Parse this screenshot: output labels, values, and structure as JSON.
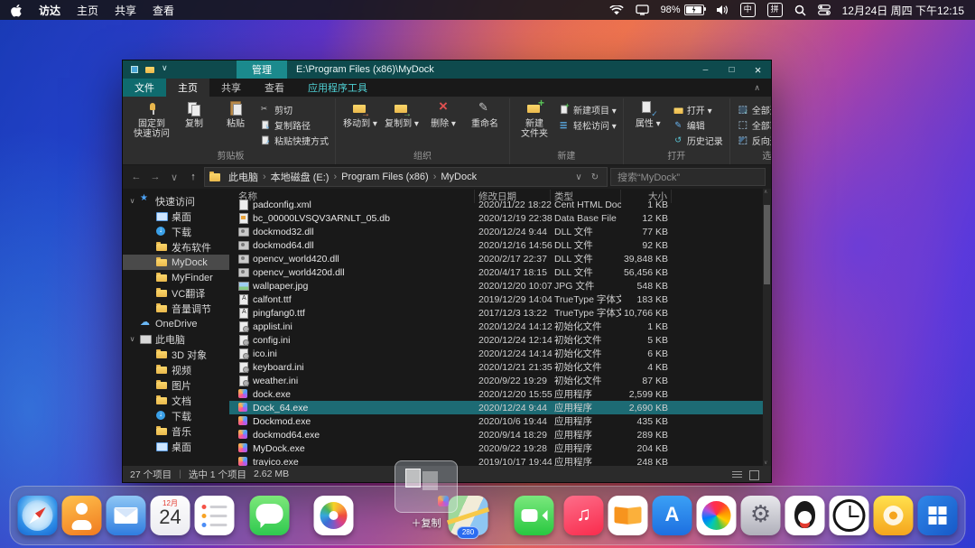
{
  "colors": {
    "accent_teal": "#1b8a8d",
    "selection_teal": "#1d6b74",
    "title_bar": "#0e4a4d"
  },
  "menubar": {
    "items": [
      "访达",
      "主页",
      "共享",
      "查看"
    ],
    "battery": "98%",
    "ime1": "中",
    "ime2": "拼",
    "datetime": "12月24日 周四 下午12:15"
  },
  "explorer": {
    "titlebar": {
      "contextual_tab": "管理",
      "title": "E:\\Program Files (x86)\\MyDock"
    },
    "tabs": [
      {
        "key": "file",
        "label": "文件",
        "file": true
      },
      {
        "key": "home",
        "label": "主页",
        "active": true
      },
      {
        "key": "share",
        "label": "共享"
      },
      {
        "key": "view",
        "label": "查看"
      },
      {
        "key": "app-tools",
        "label": "应用程序工具",
        "contextual": true
      }
    ],
    "ribbon_groups": [
      {
        "key": "clipboard",
        "label": "剪贴板",
        "large": [
          {
            "key": "pin-quick-access",
            "icon": "pin",
            "lines": [
              "固定到",
              "快速访问"
            ]
          },
          {
            "key": "copy",
            "icon": "copy",
            "lines": [
              "复制"
            ]
          },
          {
            "key": "paste",
            "icon": "paste",
            "lines": [
              "粘贴"
            ]
          }
        ],
        "small": [
          {
            "key": "cut",
            "icon": "cut",
            "label": "剪切"
          },
          {
            "key": "copy-path",
            "icon": "copypath",
            "label": "复制路径"
          },
          {
            "key": "paste-shortcut",
            "icon": "shortcut",
            "label": "粘贴快捷方式"
          }
        ]
      },
      {
        "key": "organize",
        "label": "组织",
        "large": [
          {
            "key": "move-to",
            "icon": "moveto",
            "lines": [
              "移动到"
            ],
            "dropdown": true
          },
          {
            "key": "copy-to",
            "icon": "copyto",
            "lines": [
              "复制到"
            ],
            "dropdown": true
          },
          {
            "key": "delete",
            "icon": "delete",
            "lines": [
              "删除"
            ],
            "dropdown": true
          },
          {
            "key": "rename",
            "icon": "rename",
            "lines": [
              "重命名"
            ]
          }
        ],
        "small": []
      },
      {
        "key": "new",
        "label": "新建",
        "large": [
          {
            "key": "new-folder",
            "icon": "newfolder",
            "lines": [
              "新建",
              "文件夹"
            ]
          }
        ],
        "small": [
          {
            "key": "new-item",
            "icon": "newitem",
            "label": "新建项目",
            "dropdown": true
          },
          {
            "key": "easy-access",
            "icon": "easyaccess",
            "label": "轻松访问",
            "dropdown": true
          }
        ]
      },
      {
        "key": "open",
        "label": "打开",
        "large": [
          {
            "key": "properties",
            "icon": "props",
            "lines": [
              "属性"
            ],
            "dropdown": true
          }
        ],
        "small": [
          {
            "key": "open",
            "icon": "open",
            "label": "打开",
            "dropdown": true
          },
          {
            "key": "edit",
            "icon": "edit",
            "label": "编辑"
          },
          {
            "key": "history",
            "icon": "history",
            "label": "历史记录"
          }
        ]
      },
      {
        "key": "select",
        "label": "选择",
        "large": [],
        "small": [
          {
            "key": "select-all",
            "icon": "selall",
            "label": "全部选择"
          },
          {
            "key": "select-none",
            "icon": "selnone",
            "label": "全部取消选择"
          },
          {
            "key": "invert-selection",
            "icon": "selinv",
            "label": "反向选择"
          }
        ]
      }
    ],
    "address": {
      "crumbs": [
        "此电脑",
        "本地磁盘 (E:)",
        "Program Files (x86)",
        "MyDock"
      ],
      "search_text": "搜索“MyDock”"
    },
    "sidebar": [
      {
        "key": "quick-access",
        "label": "快速访问",
        "level": 0,
        "icon": "star",
        "expand": true
      },
      {
        "key": "desktop-pinned",
        "label": "桌面",
        "level": 1,
        "icon": "monitor"
      },
      {
        "key": "downloads-pinned",
        "label": "下载",
        "level": 1,
        "icon": "download"
      },
      {
        "key": "release-software",
        "label": "发布软件",
        "level": 1,
        "icon": "folder"
      },
      {
        "key": "mydock",
        "label": "MyDock",
        "level": 1,
        "icon": "folder",
        "selected": true
      },
      {
        "key": "myfinder",
        "label": "MyFinder",
        "level": 1,
        "icon": "folder"
      },
      {
        "key": "vc-translate",
        "label": "VC翻译",
        "level": 1,
        "icon": "folder"
      },
      {
        "key": "volume-adjust",
        "label": "音量调节",
        "level": 1,
        "icon": "folder"
      },
      {
        "key": "onedrive",
        "label": "OneDrive",
        "level": 0,
        "icon": "cloud"
      },
      {
        "key": "this-pc",
        "label": "此电脑",
        "level": 0,
        "icon": "pc",
        "expand": true
      },
      {
        "key": "objects-3d",
        "label": "3D 对象",
        "level": 1,
        "icon": "folder"
      },
      {
        "key": "videos",
        "label": "视频",
        "level": 1,
        "icon": "folder"
      },
      {
        "key": "pictures",
        "label": "图片",
        "level": 1,
        "icon": "folder"
      },
      {
        "key": "documents",
        "label": "文档",
        "level": 1,
        "icon": "folder"
      },
      {
        "key": "downloads",
        "label": "下载",
        "level": 1,
        "icon": "download"
      },
      {
        "key": "music",
        "label": "音乐",
        "level": 1,
        "icon": "folder"
      },
      {
        "key": "desktop",
        "label": "桌面",
        "level": 1,
        "icon": "monitor"
      }
    ],
    "files": {
      "columns": [
        "名称",
        "修改日期",
        "类型",
        "大小"
      ],
      "rows": [
        {
          "name": "padconfig.xml",
          "date": "2020/11/22 18:22",
          "type": "Cent HTML Doc...",
          "size": "1 KB",
          "icon": "doc"
        },
        {
          "name": "bc_00000LVSQV3ARNLT_05.db",
          "date": "2020/12/19 22:38",
          "type": "Data Base File",
          "size": "12 KB",
          "icon": "db"
        },
        {
          "name": "dockmod32.dll",
          "date": "2020/12/24 9:44",
          "type": "DLL 文件",
          "size": "77 KB",
          "icon": "dll"
        },
        {
          "name": "dockmod64.dll",
          "date": "2020/12/16 14:56",
          "type": "DLL 文件",
          "size": "92 KB",
          "icon": "dll"
        },
        {
          "name": "opencv_world420.dll",
          "date": "2020/2/17 22:37",
          "type": "DLL 文件",
          "size": "39,848 KB",
          "icon": "dll"
        },
        {
          "name": "opencv_world420d.dll",
          "date": "2020/4/17 18:15",
          "type": "DLL 文件",
          "size": "56,456 KB",
          "icon": "dll"
        },
        {
          "name": "wallpaper.jpg",
          "date": "2020/12/20 10:07",
          "type": "JPG 文件",
          "size": "548 KB",
          "icon": "img"
        },
        {
          "name": "calfont.ttf",
          "date": "2019/12/29 14:04",
          "type": "TrueType 字体文件",
          "size": "183 KB",
          "icon": "font"
        },
        {
          "name": "pingfang0.ttf",
          "date": "2017/12/3 13:22",
          "type": "TrueType 字体文件",
          "size": "10,766 KB",
          "icon": "font"
        },
        {
          "name": "applist.ini",
          "date": "2020/12/24 14:12",
          "type": "初始化文件",
          "size": "1 KB",
          "icon": "ini"
        },
        {
          "name": "config.ini",
          "date": "2020/12/24 12:14",
          "type": "初始化文件",
          "size": "5 KB",
          "icon": "ini"
        },
        {
          "name": "ico.ini",
          "date": "2020/12/24 14:14",
          "type": "初始化文件",
          "size": "6 KB",
          "icon": "ini"
        },
        {
          "name": "keyboard.ini",
          "date": "2020/12/21 21:35",
          "type": "初始化文件",
          "size": "4 KB",
          "icon": "ini"
        },
        {
          "name": "weather.ini",
          "date": "2020/9/22 19:29",
          "type": "初始化文件",
          "size": "87 KB",
          "icon": "ini"
        },
        {
          "name": "dock.exe",
          "date": "2020/12/20 15:55",
          "type": "应用程序",
          "size": "2,599 KB",
          "icon": "exe"
        },
        {
          "name": "Dock_64.exe",
          "date": "2020/12/24 9:44",
          "type": "应用程序",
          "size": "2,690 KB",
          "icon": "exe",
          "selected": true
        },
        {
          "name": "Dockmod.exe",
          "date": "2020/10/6 19:44",
          "type": "应用程序",
          "size": "435 KB",
          "icon": "exe"
        },
        {
          "name": "dockmod64.exe",
          "date": "2020/9/14 18:29",
          "type": "应用程序",
          "size": "289 KB",
          "icon": "exe"
        },
        {
          "name": "MyDock.exe",
          "date": "2020/9/22 19:28",
          "type": "应用程序",
          "size": "204 KB",
          "icon": "exe"
        },
        {
          "name": "trayico.exe",
          "date": "2019/10/17 19:44",
          "type": "应用程序",
          "size": "248 KB",
          "icon": "exe"
        }
      ]
    },
    "statusbar": {
      "items_text": "27 个项目",
      "selected_text": "选中 1 个项目",
      "selected_size": "2.62 MB"
    }
  },
  "dock": [
    {
      "key": "safari"
    },
    {
      "key": "orange-app"
    },
    {
      "key": "mail"
    },
    {
      "key": "calendar",
      "month": "12月",
      "day": "24"
    },
    {
      "key": "reminders"
    },
    {
      "key": "messages"
    },
    {
      "key": "photos"
    },
    {
      "key": "maps",
      "badge": "280"
    },
    {
      "key": "facetime"
    },
    {
      "key": "music"
    },
    {
      "key": "books"
    },
    {
      "key": "app-store"
    },
    {
      "key": "colorful-sphere"
    },
    {
      "key": "settings"
    },
    {
      "key": "qq"
    },
    {
      "key": "clock"
    },
    {
      "key": "yellow-app"
    },
    {
      "key": "windows"
    }
  ],
  "drag": {
    "label": "＋复制"
  }
}
